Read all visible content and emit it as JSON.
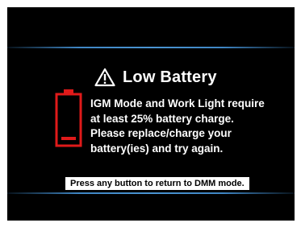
{
  "dialog": {
    "title": "Low Battery",
    "title_icon": "warning-triangle-icon",
    "battery_icon": "low-battery-icon",
    "battery_color": "#e01a1a",
    "accent_color": "#3f86c4",
    "message_lines": [
      "IGM Mode and Work Light require",
      "at least 25% battery charge.",
      "Please replace/charge your",
      "battery(ies) and try again."
    ],
    "hint": "Press any button to return to DMM mode."
  }
}
